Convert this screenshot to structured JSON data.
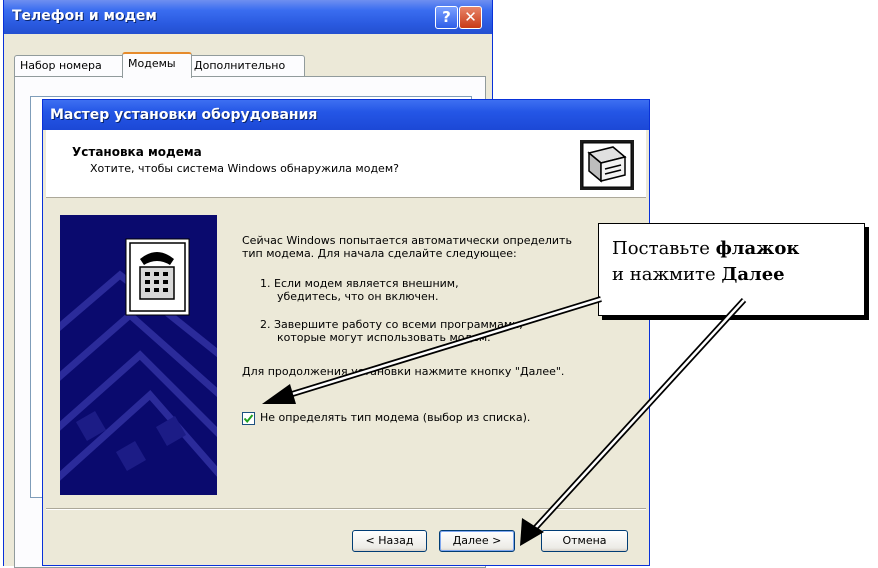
{
  "bg_window": {
    "title": "Телефон и модем",
    "help_glyph": "?",
    "close_glyph": "✕",
    "tabs": [
      {
        "label": "Набор номера"
      },
      {
        "label": "Модемы",
        "active": true
      },
      {
        "label": "Дополнительно"
      }
    ]
  },
  "wizard": {
    "title": "Мастер установки оборудования",
    "header": {
      "title": "Установка модема",
      "subtitle": "Хотите, чтобы система Windows обнаружила модем?",
      "icon": "hardware-wizard-icon"
    },
    "side_image_icon": "telephone-icon",
    "body": {
      "intro_line1": "Сейчас Windows попытается автоматически определить",
      "intro_line2": "тип модема. Для начала сделайте следующее:",
      "step1_line1": "1.  Если модем является внешним,",
      "step1_line2": "убедитесь, что он включен.",
      "step2_line1": "2.  Завершите работу со всеми программами,",
      "step2_line2": "которые могут использовать модем.",
      "continue_text": "Для продолжения установки нажмите кнопку \"Далее\".",
      "checkbox_label": "Не определять тип модема (выбор из списка).",
      "checkbox_checked": true,
      "checkmark": "✔"
    },
    "buttons": {
      "back": "< Назад",
      "next": "Далее >",
      "cancel": "Отмена"
    }
  },
  "callout": {
    "line1_prefix": "Поставьте ",
    "line1_bold": "флажок",
    "line2_prefix": "и нажмите ",
    "line2_bold": "Далее"
  },
  "colors": {
    "titlebar": "#2456e6",
    "dialog_face": "#ece9d8",
    "side_image": "#0a0a6e"
  }
}
